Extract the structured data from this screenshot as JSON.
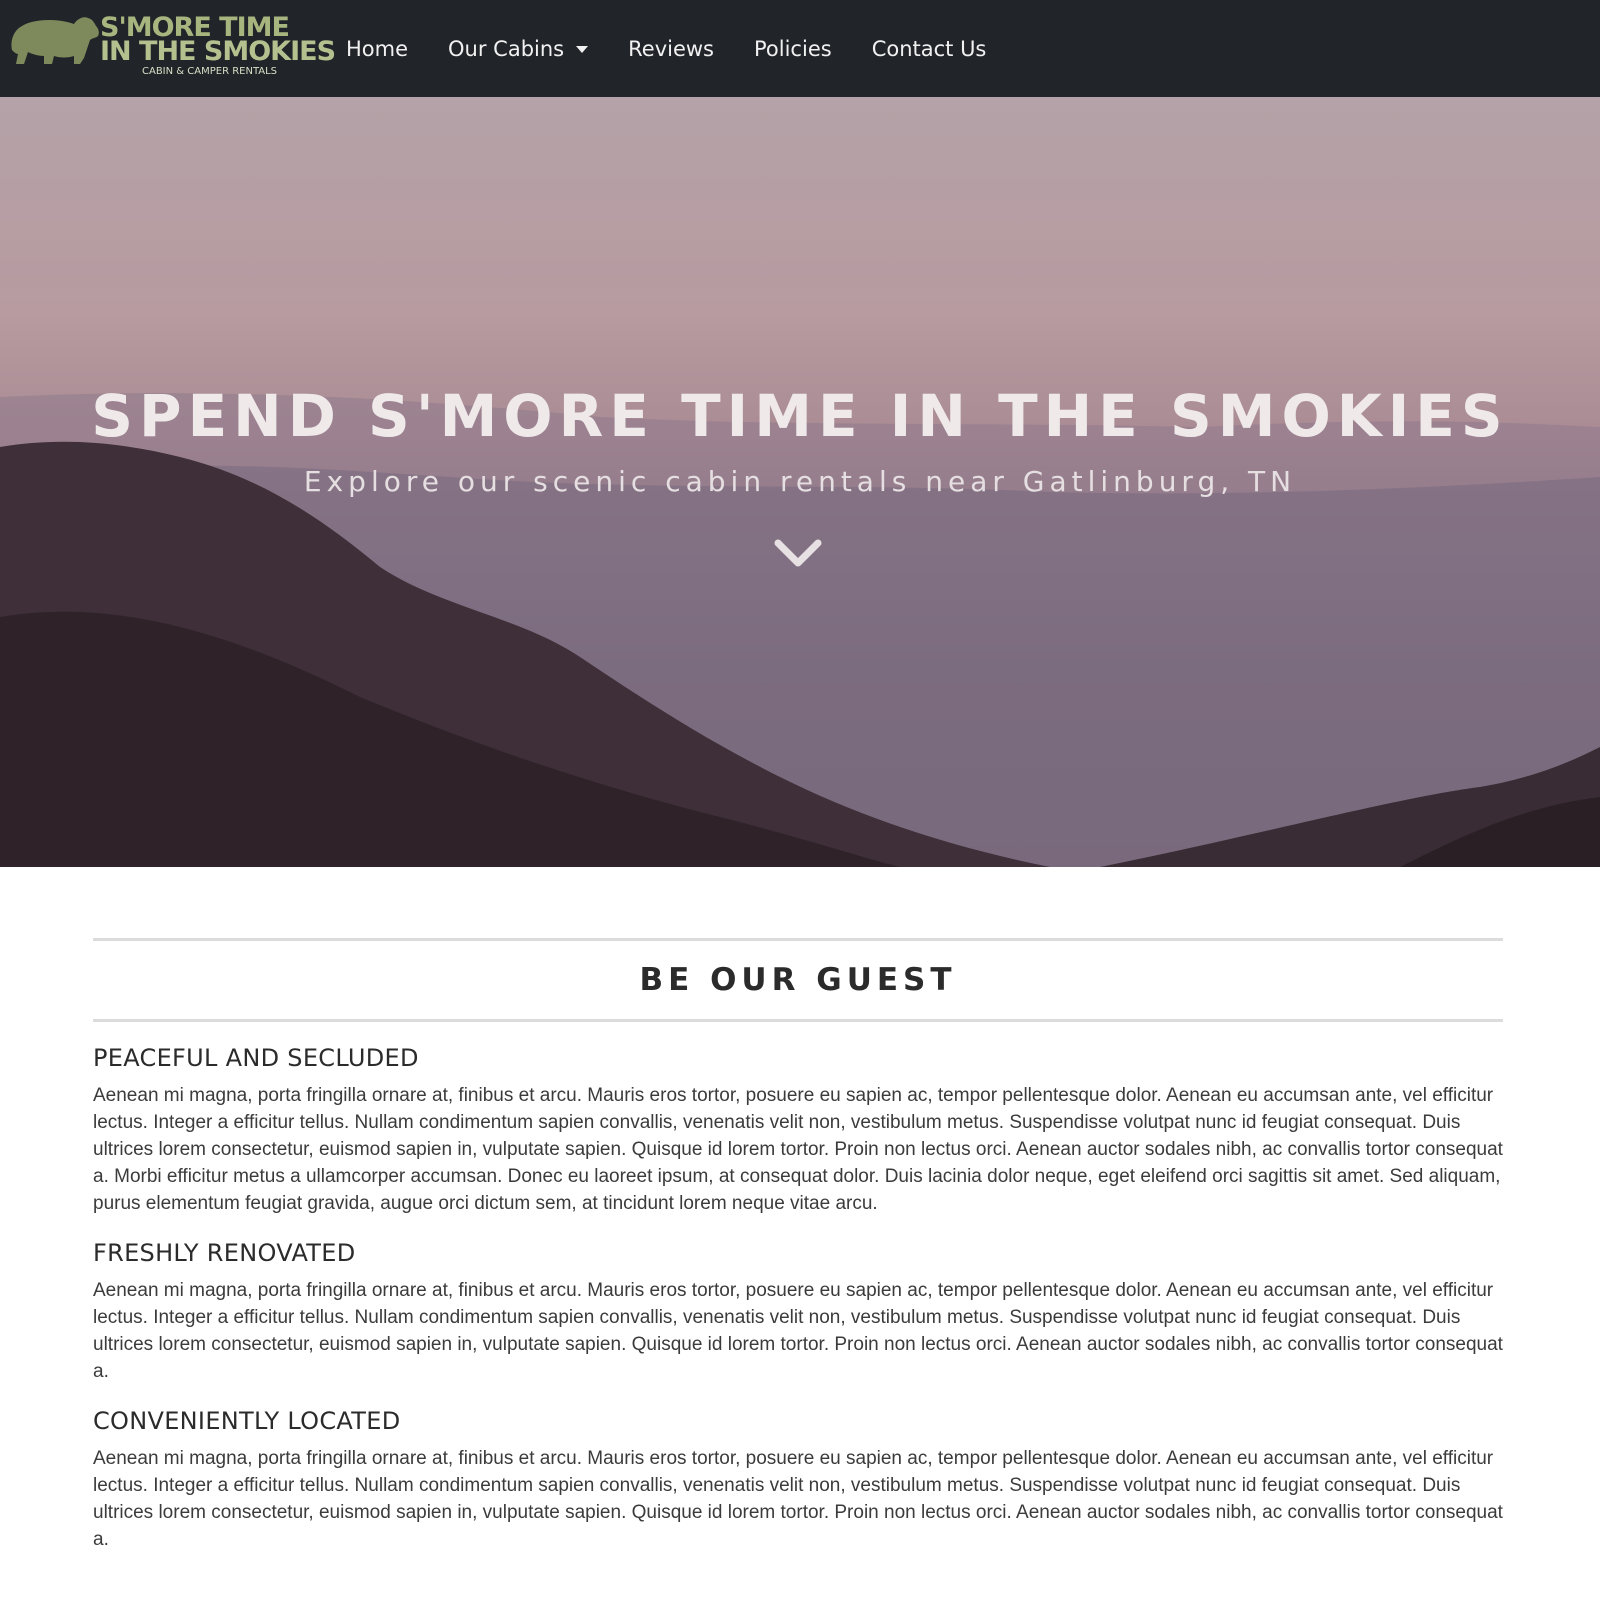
{
  "brand": {
    "line1": "S'MORE TIME",
    "line2": "IN THE SMOKIES",
    "tagline": "CABIN & CAMPER RENTALS",
    "logo_icon": "bear-icon"
  },
  "nav": {
    "items": [
      {
        "label": "Home"
      },
      {
        "label": "Our Cabins",
        "dropdown": true
      },
      {
        "label": "Reviews"
      },
      {
        "label": "Policies"
      },
      {
        "label": "Contact Us"
      }
    ]
  },
  "hero": {
    "title": "SPEND S'MORE TIME IN THE SMOKIES",
    "subtitle": "Explore our scenic cabin rentals near Gatlinburg, TN",
    "scroll_icon": "chevron-down-icon"
  },
  "main": {
    "section_title": "BE OUR GUEST",
    "features": [
      {
        "heading": "PEACEFUL AND SECLUDED",
        "text": "Aenean mi magna, porta fringilla ornare at, finibus et arcu. Mauris eros tortor, posuere eu sapien ac, tempor pellentesque dolor. Aenean eu accumsan ante, vel efficitur lectus. Integer a efficitur tellus. Nullam condimentum sapien convallis, venenatis velit non, vestibulum metus. Suspendisse volutpat nunc id feugiat consequat. Duis ultrices lorem consectetur, euismod sapien in, vulputate sapien. Quisque id lorem tortor. Proin non lectus orci. Aenean auctor sodales nibh, ac convallis tortor consequat a. Morbi efficitur metus a ullamcorper accumsan. Donec eu laoreet ipsum, at consequat dolor. Duis lacinia dolor neque, eget eleifend orci sagittis sit amet. Sed aliquam, purus elementum feugiat gravida, augue orci dictum sem, at tincidunt lorem neque vitae arcu."
      },
      {
        "heading": "FRESHLY RENOVATED",
        "text": "Aenean mi magna, porta fringilla ornare at, finibus et arcu. Mauris eros tortor, posuere eu sapien ac, tempor pellentesque dolor. Aenean eu accumsan ante, vel efficitur lectus. Integer a efficitur tellus. Nullam condimentum sapien convallis, venenatis velit non, vestibulum metus. Suspendisse volutpat nunc id feugiat consequat. Duis ultrices lorem consectetur, euismod sapien in, vulputate sapien. Quisque id lorem tortor. Proin non lectus orci. Aenean auctor sodales nibh, ac convallis tortor consequat a."
      },
      {
        "heading": "CONVENIENTLY LOCATED",
        "text": "Aenean mi magna, porta fringilla ornare at, finibus et arcu. Mauris eros tortor, posuere eu sapien ac, tempor pellentesque dolor. Aenean eu accumsan ante, vel efficitur lectus. Integer a efficitur tellus. Nullam condimentum sapien convallis, venenatis velit non, vestibulum metus. Suspendisse volutpat nunc id feugiat consequat. Duis ultrices lorem consectetur, euismod sapien in, vulputate sapien. Quisque id lorem tortor. Proin non lectus orci. Aenean auctor sodales nibh, ac convallis tortor consequat a."
      }
    ]
  },
  "colors": {
    "navbar_bg": "#212529",
    "brand_green": "#a7b57e",
    "hero_sky": "#b4a2a8",
    "text": "#3b3b3b"
  }
}
